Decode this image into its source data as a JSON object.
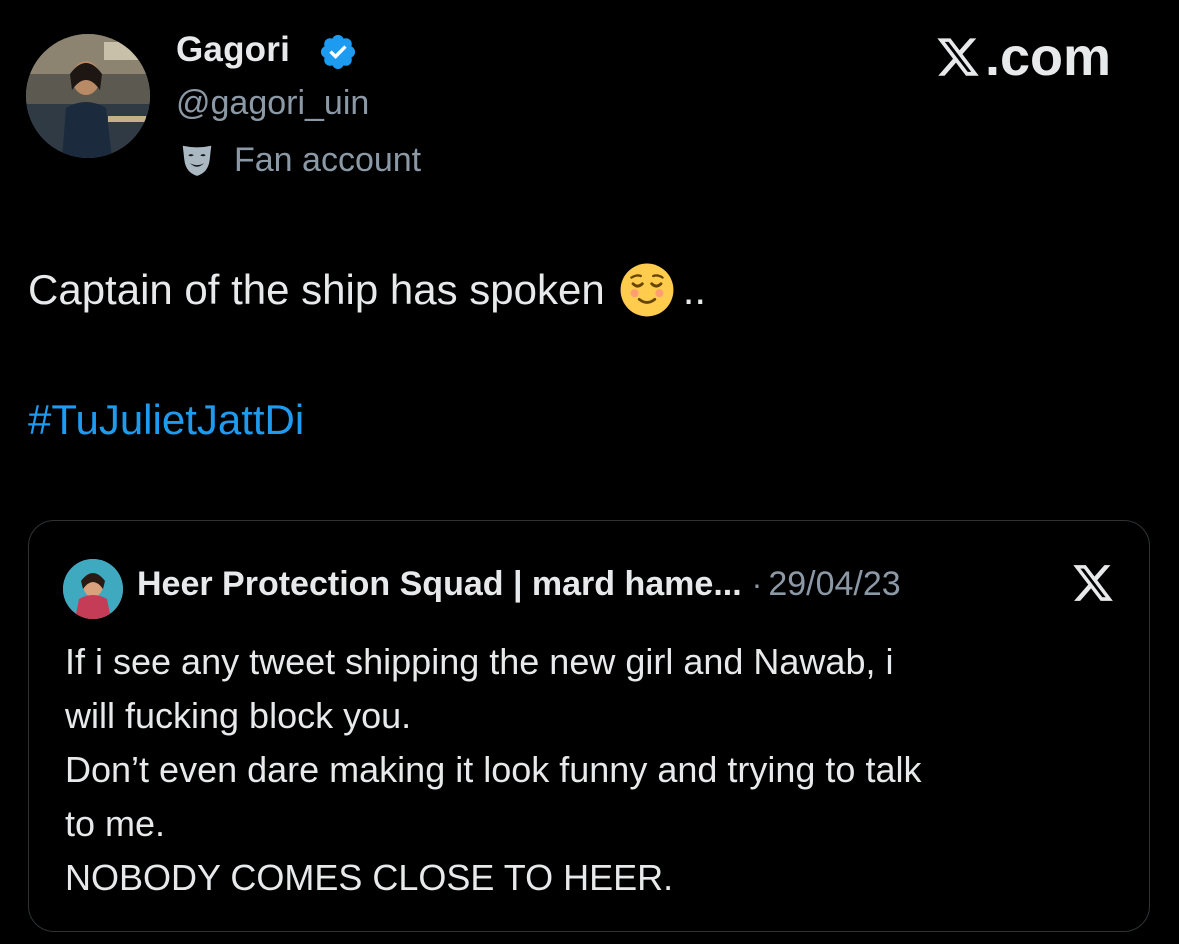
{
  "author": {
    "display_name": "Gagori",
    "handle": "@gagori_uin",
    "label": "Fan account",
    "avatar_icon": "profile-photo",
    "verified_icon": "verified-badge-icon",
    "label_icon": "theater-mask-icon"
  },
  "brand": {
    "text": ".com",
    "icon": "x-logo-icon"
  },
  "tweet": {
    "text": "Captain of the ship has spoken",
    "emoji": "relieved-face-emoji",
    "trailing": "..",
    "hashtag": "#TuJulietJattDi"
  },
  "quoted_tweet": {
    "author_name": "Heer Protection Squad | mard hame...",
    "separator": "·",
    "date": "29/04/23",
    "lines": [
      "If i see any tweet shipping the new girl and Nawab, i",
      "will fucking block you.",
      "Don’t even dare making it look funny and trying to talk",
      "to me.",
      "NOBODY COMES CLOSE TO HEER."
    ]
  },
  "colors": {
    "background": "#000000",
    "text": "#e7e9ea",
    "secondary": "#8b98a5",
    "accent": "#1d9bf0",
    "border": "#2f3336"
  }
}
